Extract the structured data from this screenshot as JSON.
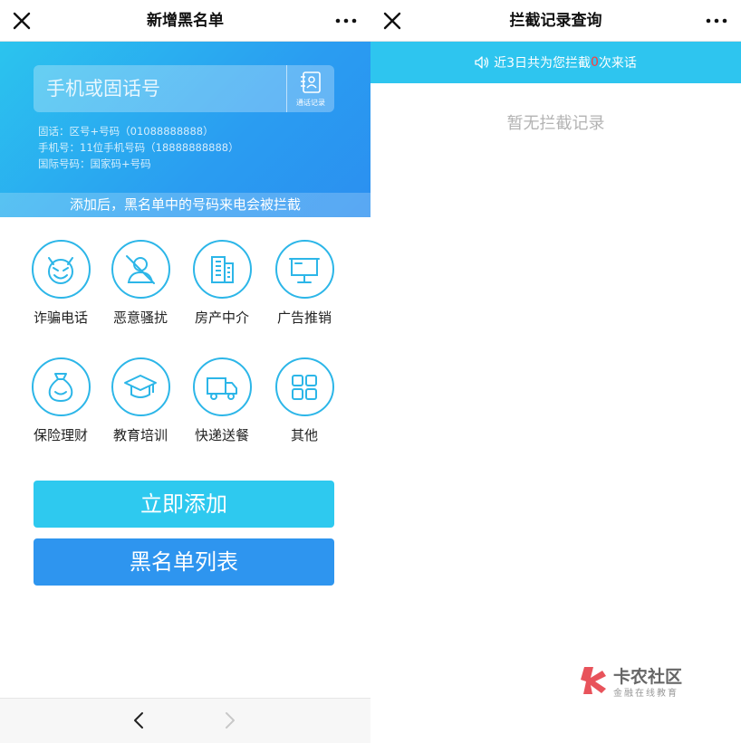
{
  "left": {
    "nav": {
      "title": "新增黑名单"
    },
    "search": {
      "placeholder": "手机或固话号",
      "contacts_label": "通话记录"
    },
    "hints": [
      "固话：区号+号码（01088888888）",
      "手机号：11位手机号码（18888888888）",
      "国际号码：国家码+号码"
    ],
    "notice": "添加后，黑名单中的号码来电会被拦截",
    "categories": [
      {
        "label": "诈骗电话",
        "icon": "devil-icon"
      },
      {
        "label": "恶意骚扰",
        "icon": "harassment-icon"
      },
      {
        "label": "房产中介",
        "icon": "building-icon"
      },
      {
        "label": "广告推销",
        "icon": "billboard-icon"
      },
      {
        "label": "保险理财",
        "icon": "money-bag-icon"
      },
      {
        "label": "教育培训",
        "icon": "graduation-cap-icon"
      },
      {
        "label": "快递送餐",
        "icon": "delivery-truck-icon"
      },
      {
        "label": "其他",
        "icon": "grid-icon"
      }
    ],
    "buttons": {
      "add": "立即添加",
      "list": "黑名单列表"
    }
  },
  "right": {
    "nav": {
      "title": "拦截记录查询"
    },
    "banner": {
      "prefix": "近3日共为您拦截",
      "count": "0",
      "suffix": "次来话"
    },
    "empty": "暂无拦截记录"
  },
  "watermark": {
    "title": "卡农社区",
    "subtitle": "金融在线教育"
  },
  "colors": {
    "accent": "#2ec9ef",
    "primary": "#2e95ef",
    "icon_stroke": "#2cb6e8"
  }
}
